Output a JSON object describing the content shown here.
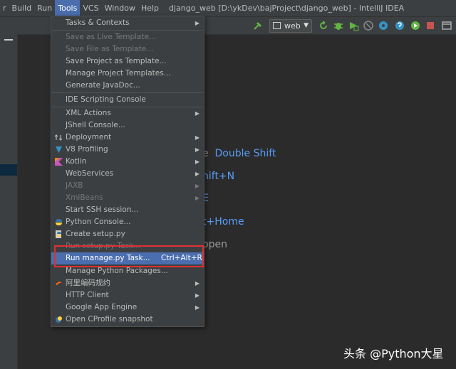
{
  "menubar": {
    "items": [
      {
        "label": "r"
      },
      {
        "label": "Build"
      },
      {
        "label": "Run"
      },
      {
        "label": "Tools",
        "active": true
      },
      {
        "label": "VCS"
      },
      {
        "label": "Window"
      },
      {
        "label": "Help"
      }
    ],
    "window_title": "django_web [D:\\ykDev\\bajProject\\django_web] - IntelliJ IDEA"
  },
  "toolbar": {
    "run_config": "web",
    "icons": [
      "hammer-icon",
      "refresh-icon",
      "bug-icon",
      "coverage-icon",
      "profile-icon",
      "settings-icon",
      "help-icon",
      "play-icon",
      "stop-icon"
    ]
  },
  "editor_hints": [
    {
      "text": "e  Double Shift",
      "grey_prefix": "e",
      "blue": "Double Shift"
    },
    {
      "text": "hift+N"
    },
    {
      "text": "E"
    },
    {
      "text": "t+Home"
    },
    {
      "text": "open"
    }
  ],
  "tools_menu": {
    "items": [
      {
        "label": "Tasks & Contexts",
        "submenu": true
      },
      {
        "label": "Save as Live Template...",
        "disabled": true
      },
      {
        "label": "Save File as Template...",
        "disabled": true
      },
      {
        "label": "Save Project as Template..."
      },
      {
        "label": "Manage Project Templates..."
      },
      {
        "label": "Generate JavaDoc..."
      },
      {
        "label": "IDE Scripting Console"
      },
      {
        "label": "XML Actions",
        "submenu": true
      },
      {
        "label": "JShell Console..."
      },
      {
        "label": "Deployment",
        "submenu": true
      },
      {
        "label": "V8 Profiling",
        "submenu": true
      },
      {
        "label": "Kotlin",
        "submenu": true
      },
      {
        "label": "WebServices",
        "submenu": true
      },
      {
        "label": "JAXB",
        "submenu": true,
        "disabled": true
      },
      {
        "label": "XmlBeans",
        "submenu": true,
        "disabled": true
      },
      {
        "label": "Start SSH session..."
      },
      {
        "label": "Python Console..."
      },
      {
        "label": "Create setup.py"
      },
      {
        "label": "Run setup.py Task...",
        "disabled": true
      },
      {
        "label": "Run manage.py Task...",
        "shortcut": "Ctrl+Alt+R",
        "selected": true
      },
      {
        "label": "Manage Python Packages..."
      },
      {
        "label": "阿里编码规约",
        "submenu": true
      },
      {
        "label": "HTTP Client",
        "submenu": true
      },
      {
        "label": "Google App Engine",
        "submenu": true
      },
      {
        "label": "Open CProfile snapshot"
      }
    ]
  },
  "watermark": "头条 @Python大星",
  "colors": {
    "accent": "#4b6eaf",
    "highlight_box": "#e03030",
    "link": "#589df6"
  }
}
